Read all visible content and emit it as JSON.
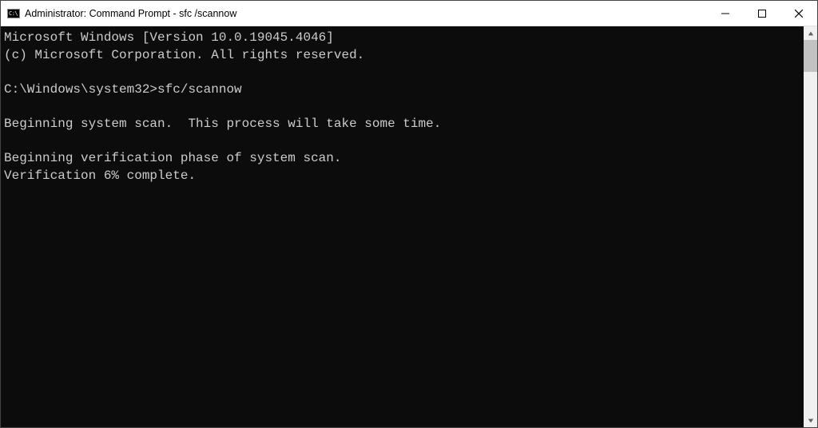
{
  "window": {
    "title": "Administrator: Command Prompt - sfc /scannow",
    "icon_text": "C:\\"
  },
  "terminal": {
    "line1_version": "Microsoft Windows [Version 10.0.19045.4046]",
    "line2_copyright": "(c) Microsoft Corporation. All rights reserved.",
    "blank1": "",
    "prompt_line": "C:\\Windows\\system32>sfc/scannow",
    "blank2": "",
    "scan_begin": "Beginning system scan.  This process will take some time.",
    "blank3": "",
    "verify_begin": "Beginning verification phase of system scan.",
    "verify_progress": "Verification 6% complete."
  }
}
